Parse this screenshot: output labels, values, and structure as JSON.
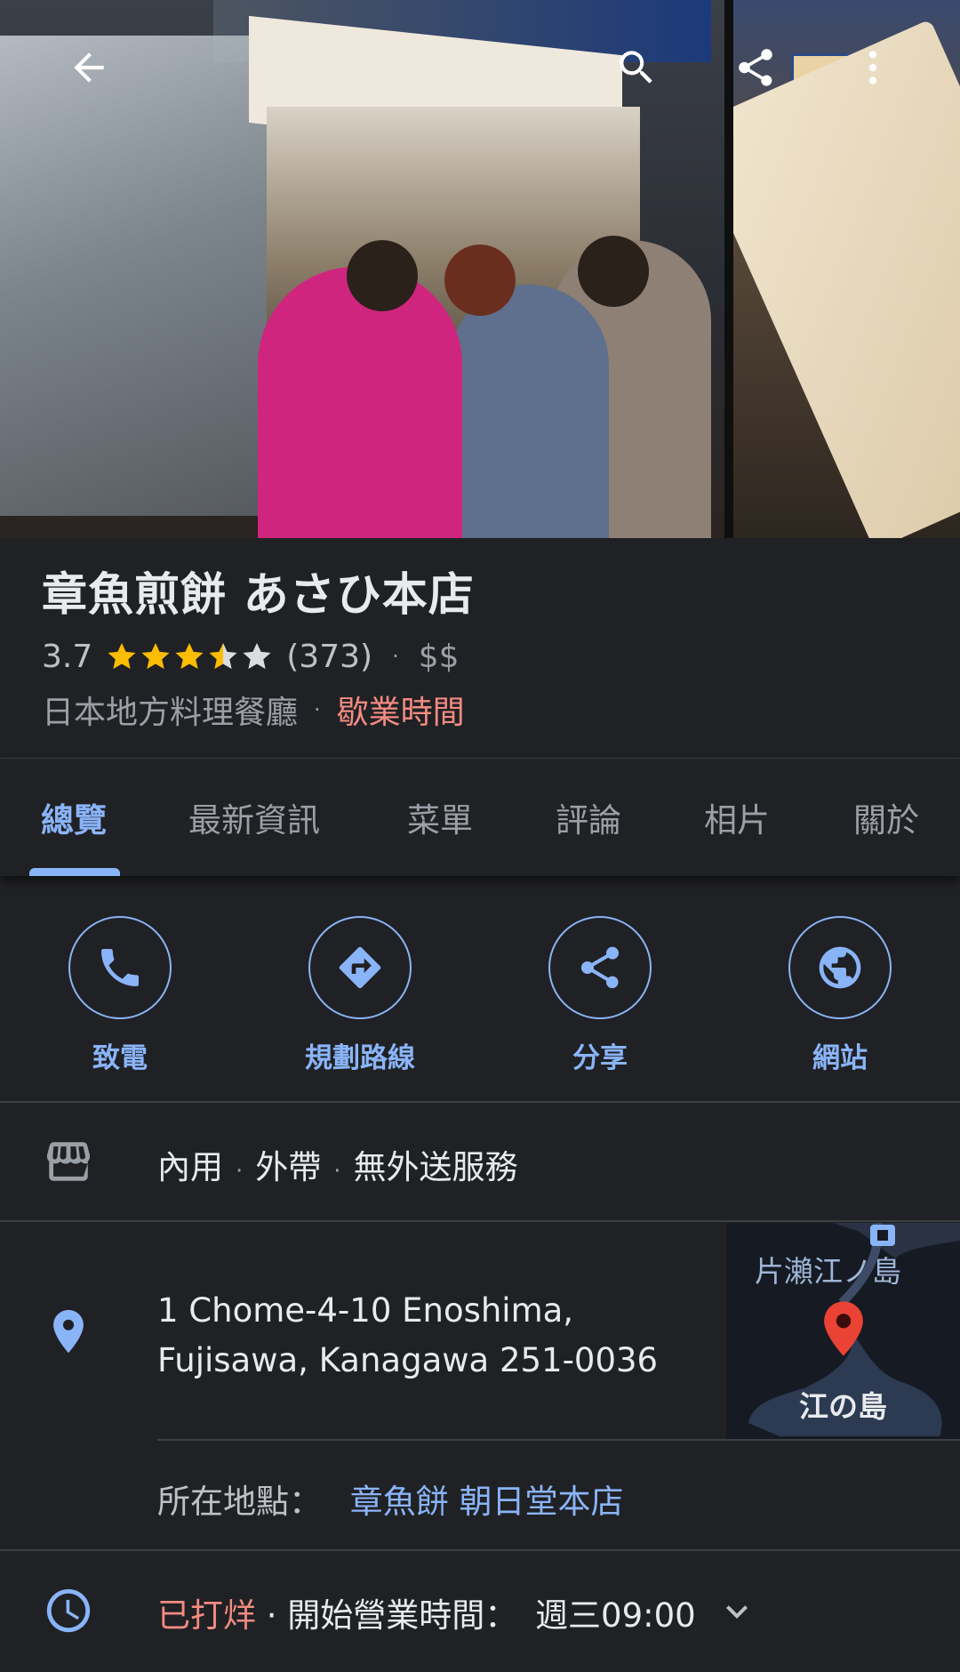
{
  "place": {
    "name": "章魚煎餅 あさひ本店",
    "rating": "3.7",
    "stars_filled": 3.5,
    "review_count": "(373)",
    "price": "$$",
    "category": "日本地方料理餐廳",
    "hours_link": "歇業時間"
  },
  "tabs": [
    {
      "label": "總覽",
      "active": true
    },
    {
      "label": "最新資訊"
    },
    {
      "label": "菜單"
    },
    {
      "label": "評論"
    },
    {
      "label": "相片"
    },
    {
      "label": "關於"
    }
  ],
  "actions": [
    {
      "label": "致電",
      "icon": "phone-icon"
    },
    {
      "label": "規劃路線",
      "icon": "directions-icon"
    },
    {
      "label": "分享",
      "icon": "share-icon"
    },
    {
      "label": "網站",
      "icon": "globe-icon"
    }
  ],
  "service": {
    "icon": "storefront-icon",
    "options": [
      "內用",
      "外帶",
      "無外送服務"
    ]
  },
  "address": {
    "icon": "location-pin-icon",
    "line1": "1 Chome-4-10 Enoshima,",
    "line2": "Fujisawa, Kanagawa 251-0036"
  },
  "map_thumbnail": {
    "label_top": "片瀨江ノ島",
    "label_bottom": "江の島"
  },
  "located_in": {
    "label": "所在地點：",
    "place": "章魚餅 朝日堂本店"
  },
  "hours": {
    "icon": "clock-icon",
    "status": "已打烊",
    "detail": "· 開始營業時間：",
    "next_open": "週三09:00"
  },
  "colors": {
    "accent": "#8ab4f8",
    "closed": "#f28b82",
    "star": "#fbbc04",
    "background": "#202124"
  }
}
